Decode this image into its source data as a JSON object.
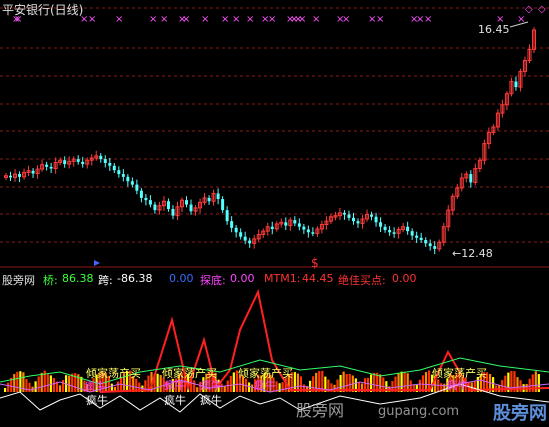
{
  "window": {
    "title": "平安银行(日线)"
  },
  "price_panel": {
    "high_label": "16.45",
    "low_label": "←12.48",
    "marker_x_symbol": "×",
    "marker_diamond_symbol": "◇",
    "marker_dollar": "$"
  },
  "indicator_panel": {
    "source": "股旁网",
    "qiao_label": "桥:",
    "qiao_value": "86.38",
    "kua_label": "跨:",
    "kua_value": "-86.38",
    "blue_value": "0.00",
    "tandi_label": "探底:",
    "tandi_value": "0.00",
    "mtm_label": "MTM1:",
    "mtm_value": "44.45",
    "juejia_label": "绝佳买点:",
    "juejia_value": "0.00",
    "overlay_texts": [
      "倾家荡产买",
      "倾家荡产买",
      "倾家荡产买",
      "倾家荡产买",
      "疯牛",
      "疯牛",
      "疯牛",
      "疯牛",
      "疯牛",
      "疯牛",
      "疯牛",
      "疯牛"
    ]
  },
  "watermark": {
    "cn": "股旁网",
    "url": "gupang.com",
    "blue": "股旁网"
  },
  "colors": {
    "up": "#ff3b3b",
    "down": "#54ffff",
    "grid": "#8b1a1a",
    "cross": "#ff55ff",
    "mtm": "#ff2020",
    "text_green": "#3cff3c",
    "text_white": "#ffffff",
    "text_blue": "#3b6bff",
    "text_magenta": "#ff44ff",
    "text_red": "#ff3333",
    "text_yellow": "#ffff66"
  },
  "chart_data": {
    "type": "candlestick",
    "title": "平安银行(日线)",
    "price_high": 16.45,
    "price_low": 12.48,
    "closes": [
      13.82,
      13.79,
      13.85,
      13.8,
      13.88,
      13.91,
      13.86,
      13.94,
      14.02,
      13.98,
      13.95,
      14.06,
      14.1,
      14.03,
      14.08,
      14.12,
      14.07,
      14.03,
      14.1,
      14.14,
      14.18,
      14.12,
      14.05,
      14.0,
      13.92,
      13.85,
      13.8,
      13.72,
      13.66,
      13.55,
      13.42,
      13.38,
      13.3,
      13.2,
      13.28,
      13.36,
      13.22,
      13.1,
      13.26,
      13.38,
      13.3,
      13.18,
      13.24,
      13.34,
      13.42,
      13.36,
      13.5,
      13.4,
      13.2,
      13.0,
      12.88,
      12.8,
      12.72,
      12.65,
      12.6,
      12.68,
      12.76,
      12.82,
      12.9,
      12.86,
      12.95,
      12.98,
      12.92,
      13.02,
      12.96,
      12.9,
      12.85,
      12.8,
      12.78,
      12.86,
      12.94,
      13.0,
      13.08,
      13.1,
      13.15,
      13.12,
      13.06,
      13.0,
      12.96,
      13.04,
      13.12,
      13.08,
      12.98,
      12.9,
      12.84,
      12.8,
      12.78,
      12.85,
      12.9,
      12.82,
      12.74,
      12.7,
      12.66,
      12.6,
      12.55,
      12.5,
      12.62,
      12.9,
      13.2,
      13.45,
      13.6,
      13.78,
      13.85,
      13.7,
      13.95,
      14.1,
      14.4,
      14.6,
      14.7,
      14.95,
      15.1,
      15.3,
      15.52,
      15.42,
      15.7,
      15.9,
      16.1,
      16.45
    ],
    "mtm1": 44.45,
    "qiao": 86.38,
    "kua": -86.38,
    "tandi": 0.0,
    "juejia_maidian": 0.0,
    "blue_value": 0.0
  }
}
